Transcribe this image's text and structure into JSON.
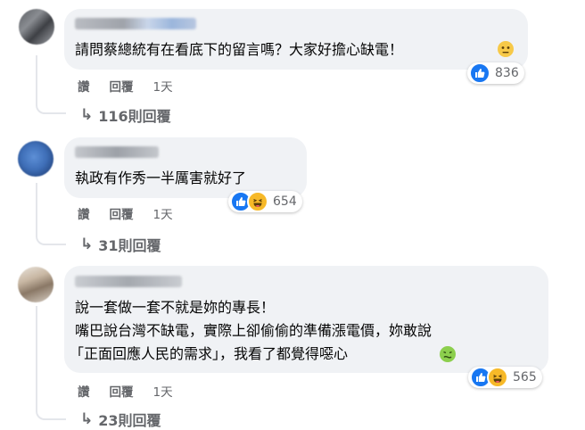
{
  "comments": [
    {
      "lines": [
        "請問蔡總統有在看底下的留言嗎？大家好擔心缺電！"
      ],
      "reactions": [
        "like"
      ],
      "reaction_count": "836",
      "actions": {
        "like": "讚",
        "reply": "回覆",
        "time": "1天"
      },
      "replies_label": "116則回覆"
    },
    {
      "lines": [
        "執政有作秀一半厲害就好了"
      ],
      "reactions": [
        "like",
        "haha"
      ],
      "reaction_count": "654",
      "actions": {
        "like": "讚",
        "reply": "回覆",
        "time": "1天"
      },
      "replies_label": "31則回覆"
    },
    {
      "lines": [
        "說一套做一套不就是妳的專長！",
        "嘴巴說台灣不缺電，實際上卻偷偷的準備漲電價，妳敢說",
        "「正面回應人民的需求」，我看了都覺得噁心"
      ],
      "reactions": [
        "like",
        "haha"
      ],
      "reaction_count": "565",
      "actions": {
        "like": "讚",
        "reply": "回覆",
        "time": "1天"
      },
      "replies_label": "23則回覆"
    }
  ],
  "colors": {
    "bubble": "#f0f2f5",
    "like_blue": "#1877f2",
    "haha_yellow": "#f7b928",
    "meta_gray": "#65676b"
  }
}
